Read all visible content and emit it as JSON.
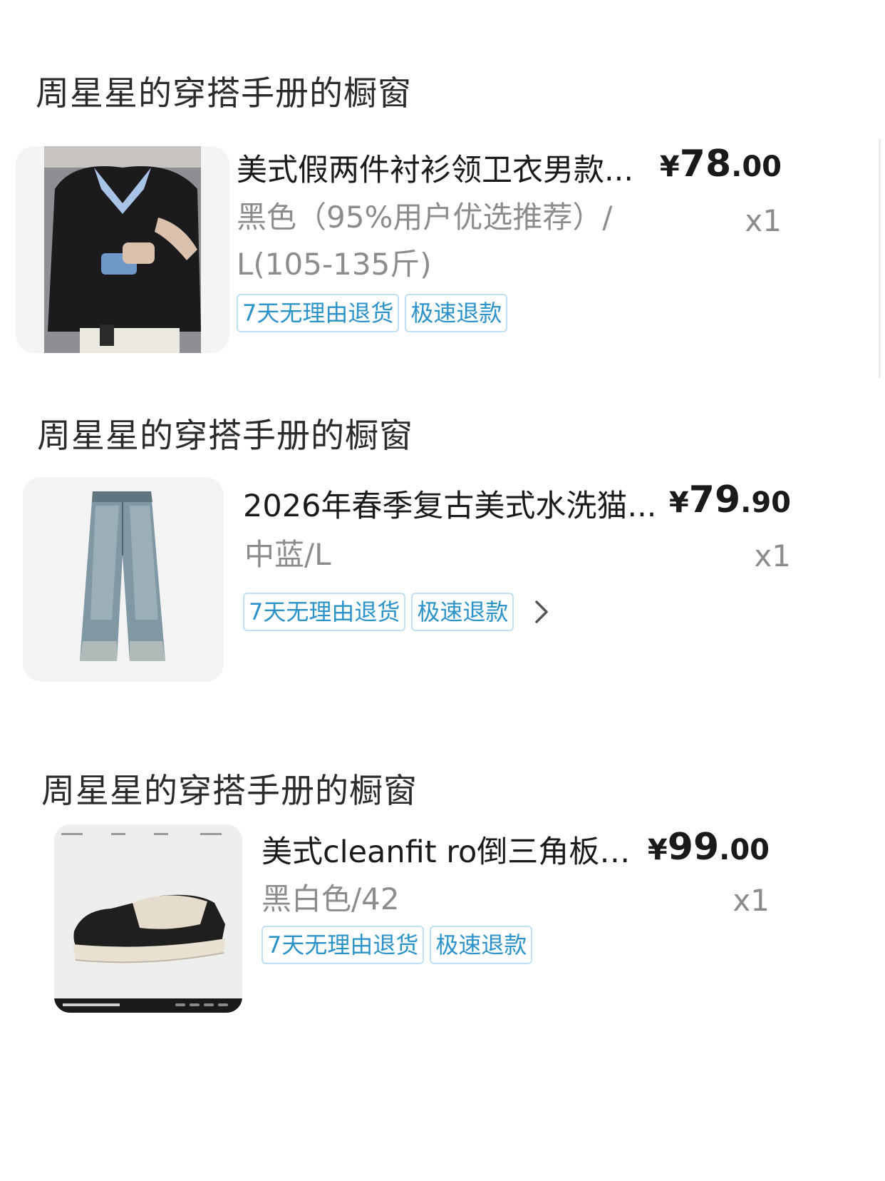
{
  "stores": [
    {
      "shop_title": "周星星的穿搭手册的橱窗",
      "product_name": "美式假两件衬衫领卫衣男款...",
      "price_currency": "¥",
      "price_integer": "78",
      "price_decimal": ".00",
      "sku_line1": "黑色（95%用户优选推荐）/",
      "sku_line2": "L(105-135斤)",
      "quantity": "x1",
      "tags": [
        "7天无理由退货",
        "极速退款"
      ],
      "image_icon": "black-hoodie-with-shirt-collar-photo"
    },
    {
      "shop_title": "周星星的穿搭手册的橱窗",
      "product_name": "2026年春季复古美式水洗猫...",
      "price_currency": "¥",
      "price_integer": "79",
      "price_decimal": ".90",
      "sku_line1": "中蓝/L",
      "quantity": "x1",
      "tags": [
        "7天无理由退货",
        "极速退款"
      ],
      "image_icon": "washed-blue-jeans-photo"
    },
    {
      "shop_title": "周星星的穿搭手册的橱窗",
      "product_name": "美式cleanfit ro倒三角板鞋...",
      "price_currency": "¥",
      "price_integer": "99",
      "price_decimal": ".00",
      "sku_line1": "黑白色/42",
      "quantity": "x1",
      "tags": [
        "7天无理由退货",
        "极速退款"
      ],
      "image_icon": "black-white-sneaker-photo"
    }
  ],
  "colors": {
    "tag_text": "#2b93c9",
    "tag_border": "#bfe0f2",
    "sku_gray": "#8c8c8c"
  }
}
